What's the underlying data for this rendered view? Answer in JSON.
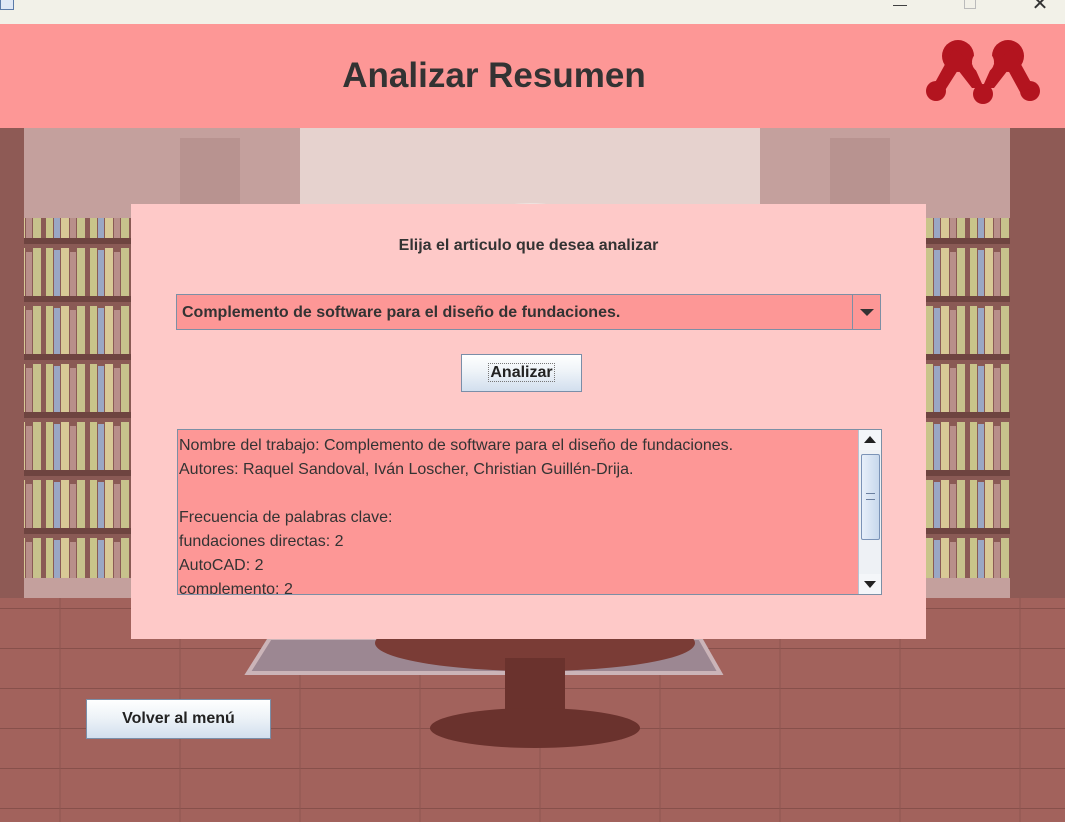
{
  "window": {
    "min_glyph": "—",
    "close_glyph": "✕"
  },
  "header": {
    "title": "Analizar Resumen",
    "logo_icon": "mendeley-logo-icon",
    "bg_color": "#fd9796"
  },
  "panel": {
    "prompt": "Elija el articulo que desea analizar",
    "article_select": {
      "value": "Complemento de software para el diseño de fundaciones."
    },
    "analyze_label": "Analizar",
    "result_lines": [
      "Nombre del trabajo: Complemento de software para el diseño de fundaciones.",
      "Autores: Raquel Sandoval, Iván Loscher, Christian Guillén-Drija.",
      "",
      "Frecuencia de palabras clave:",
      "fundaciones directas: 2",
      "AutoCAD: 2",
      "complemento: 2"
    ]
  },
  "footer": {
    "back_label": "Volver al menú"
  },
  "colors": {
    "panel_bg": "#fec9c8",
    "field_bg": "#fd9796",
    "text": "#333333"
  }
}
